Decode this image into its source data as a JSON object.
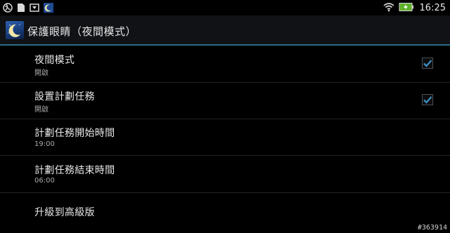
{
  "status_bar": {
    "left_icons": [
      "globe-icon",
      "sd-card-icon",
      "download-icon",
      "app-notification-icon"
    ],
    "right_icons": [
      "wifi-icon",
      "battery-charging-icon"
    ],
    "time": "16:25"
  },
  "header": {
    "app_icon": "crescent-moon-icon",
    "title": "保護眼睛（夜間模式）"
  },
  "settings": [
    {
      "title": "夜間模式",
      "summary": "開啟",
      "checked": true
    },
    {
      "title": "設置計劃任務",
      "summary": "開啟",
      "checked": true
    },
    {
      "title": "計劃任務開始時間",
      "summary": "19:00"
    },
    {
      "title": "計劃任務結束時間",
      "summary": "06:00"
    },
    {
      "title": "升級到高級版"
    }
  ],
  "watermark": "#363914",
  "colors": {
    "accent_divider": "#2b6f86",
    "checkbox_check": "#3e8bbf",
    "background": "#000000"
  }
}
